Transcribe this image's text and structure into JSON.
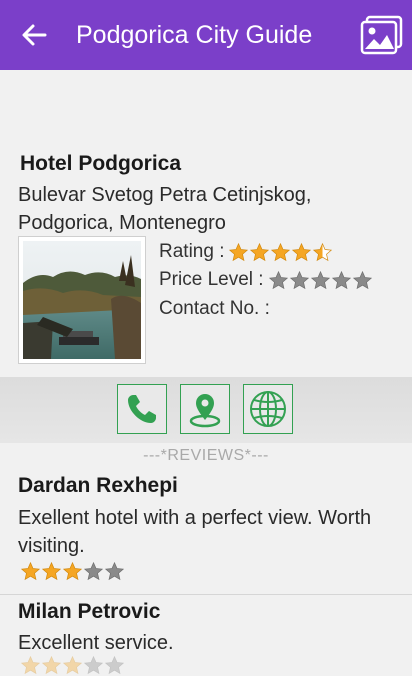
{
  "app_bar": {
    "title": "Podgorica City Guide"
  },
  "hotel": {
    "name": "Hotel Podgorica",
    "address": "Bulevar Svetog Petra Cetinjskog, Podgorica, Montenegro",
    "rating_label": "Rating :",
    "rating": 4.5,
    "price_label": "Price Level :",
    "price_level": 0,
    "contact_label": "Contact No. :",
    "contact_value": ""
  },
  "actions": {
    "call_icon": "phone-icon",
    "map_icon": "map-pin-icon",
    "web_icon": "globe-icon"
  },
  "reviews_header": "---*REVIEWS*---",
  "reviews": [
    {
      "name": "Dardan Rexhepi",
      "text": "Exellent hotel with a perfect view. Worth visiting.",
      "rating": 3
    },
    {
      "name": "Milan Petrovic",
      "text": "Excellent service.",
      "rating": 3
    }
  ],
  "colors": {
    "app_bar": "#7b3fc9",
    "star_filled": "#f5a623",
    "star_empty": "#8a8a8a",
    "action_icon": "#33a152"
  }
}
